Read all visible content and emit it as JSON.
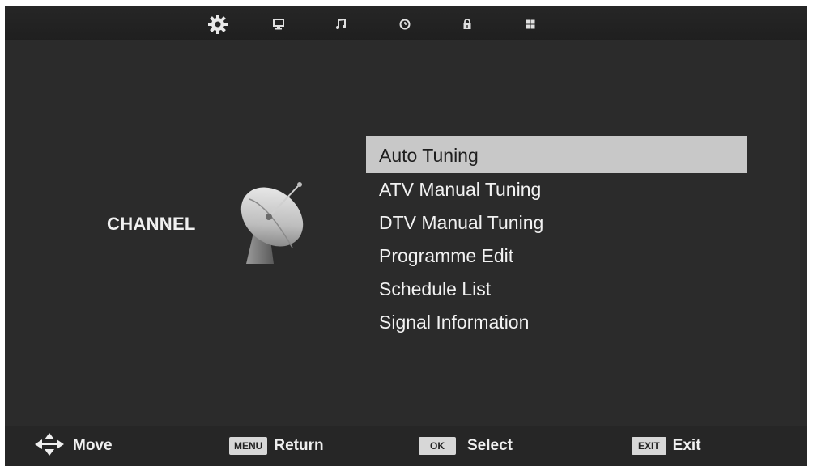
{
  "topbar": {
    "tabs": [
      {
        "icon": "gear-icon",
        "active": true
      },
      {
        "icon": "monitor-icon",
        "active": false
      },
      {
        "icon": "music-note-icon",
        "active": false
      },
      {
        "icon": "clock-icon",
        "active": false
      },
      {
        "icon": "lock-icon",
        "active": false
      },
      {
        "icon": "grid-icon",
        "active": false
      }
    ]
  },
  "side": {
    "label": "CHANNEL",
    "icon": "satellite-dish-icon"
  },
  "menu": {
    "items": [
      {
        "label": "Auto Tuning",
        "selected": true
      },
      {
        "label": "ATV Manual Tuning",
        "selected": false
      },
      {
        "label": "DTV Manual Tuning",
        "selected": false
      },
      {
        "label": "Programme Edit",
        "selected": false
      },
      {
        "label": "Schedule List",
        "selected": false
      },
      {
        "label": "Signal Information",
        "selected": false
      }
    ]
  },
  "footer": {
    "move_label": "Move",
    "menu_key": "MENU",
    "return_label": "Return",
    "ok_key": "OK",
    "select_label": "Select",
    "exit_key": "EXIT",
    "exit_label": "Exit"
  },
  "colors": {
    "background": "#2b2b2b",
    "bars": "#262626",
    "highlight": "#c8c8c8",
    "text": "#f2f2f2"
  }
}
